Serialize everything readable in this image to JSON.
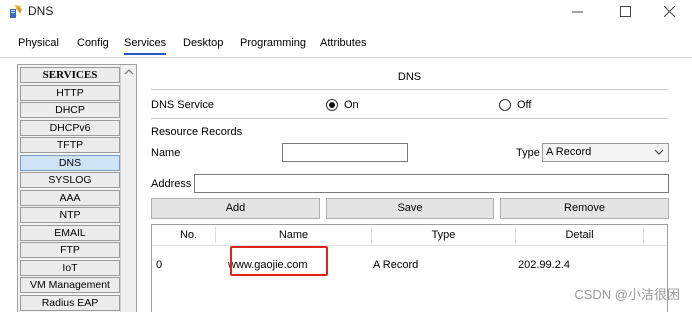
{
  "window": {
    "title": "DNS",
    "controls": {
      "minimize": "—",
      "maximize": "☐",
      "close": "✕"
    }
  },
  "tabs": [
    {
      "label": "Physical",
      "active": false
    },
    {
      "label": "Config",
      "active": false
    },
    {
      "label": "Services",
      "active": true
    },
    {
      "label": "Desktop",
      "active": false
    },
    {
      "label": "Programming",
      "active": false
    },
    {
      "label": "Attributes",
      "active": false
    }
  ],
  "sidebar": {
    "header": "SERVICES",
    "items": [
      "HTTP",
      "DHCP",
      "DHCPv6",
      "TFTP",
      "DNS",
      "SYSLOG",
      "AAA",
      "NTP",
      "EMAIL",
      "FTP",
      "IoT",
      "VM Management",
      "Radius EAP"
    ],
    "selected": "DNS"
  },
  "panel": {
    "title": "DNS",
    "dns_service_label": "DNS Service",
    "on_label": "On",
    "off_label": "Off",
    "service_state": "On",
    "resource_records_label": "Resource Records",
    "name_label": "Name",
    "name_value": "",
    "type_label": "Type",
    "type_value": "A Record",
    "address_label": "Address",
    "address_value": "",
    "add_label": "Add",
    "save_label": "Save",
    "remove_label": "Remove"
  },
  "table": {
    "columns": [
      "No.",
      "Name",
      "Type",
      "Detail"
    ],
    "rows": [
      {
        "no": "0",
        "name": "www.gaojie.com",
        "type": "A Record",
        "detail": "202.99.2.4"
      }
    ]
  },
  "watermark": "CSDN @小洁很困",
  "colors": {
    "tab_underline": "#2b56c4",
    "highlight_box": "#e0221f",
    "selected_item": "#cfe3f7"
  }
}
